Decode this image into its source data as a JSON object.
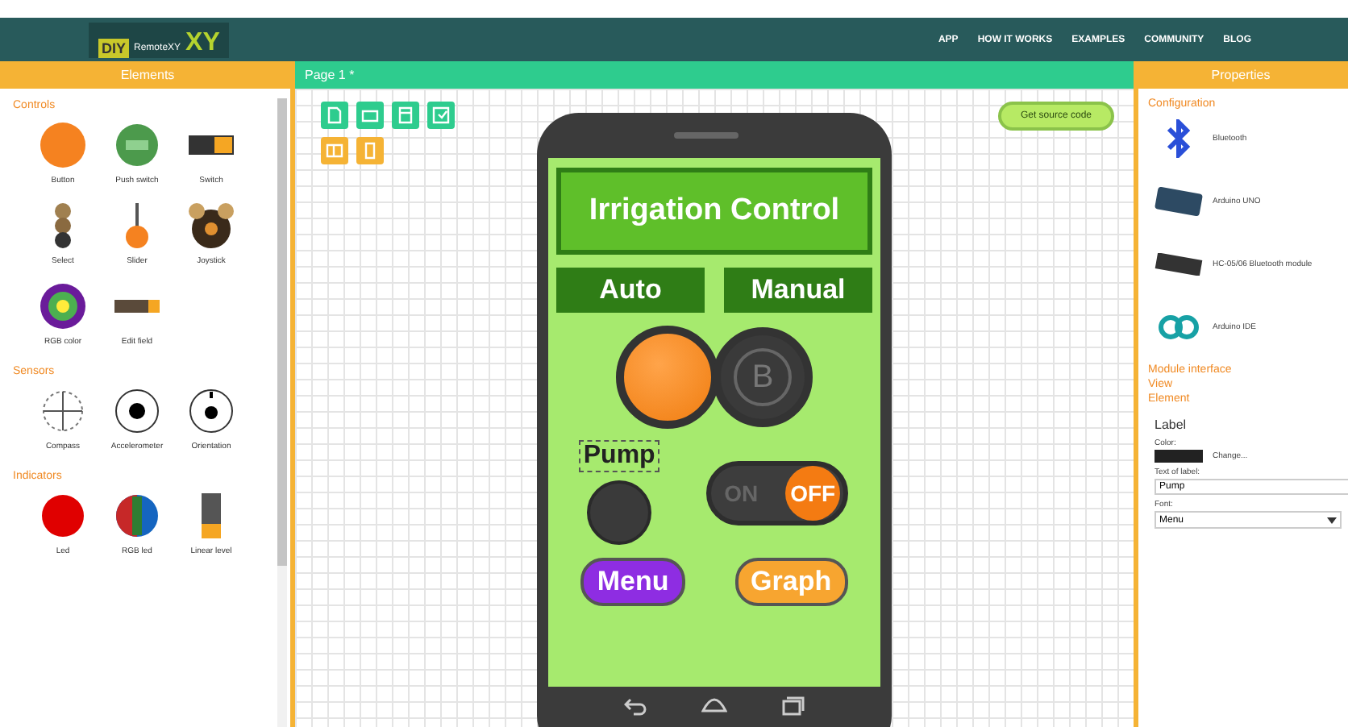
{
  "logo": {
    "badge": "DIY",
    "mark": "XY",
    "sub": "RemoteXY"
  },
  "nav": [
    "APP",
    "HOW IT WORKS",
    "EXAMPLES",
    "COMMUNITY",
    "BLOG"
  ],
  "panels": {
    "left": "Elements",
    "center": "Page 1 *",
    "right": "Properties"
  },
  "palette": [
    {
      "title": "Controls",
      "items": [
        {
          "kind": "button",
          "label": "Button"
        },
        {
          "kind": "push",
          "label": "Push switch"
        },
        {
          "kind": "switch",
          "label": "Switch"
        },
        {
          "kind": "select",
          "label": "Select"
        },
        {
          "kind": "slider",
          "label": "Slider"
        },
        {
          "kind": "joystick",
          "label": "Joystick"
        },
        {
          "kind": "rgb",
          "label": "RGB color"
        },
        {
          "kind": "edit",
          "label": "Edit field"
        }
      ]
    },
    {
      "title": "Sensors",
      "items": [
        {
          "kind": "compass",
          "label": "Compass"
        },
        {
          "kind": "accel",
          "label": "Accelerometer"
        },
        {
          "kind": "orient",
          "label": "Orientation"
        }
      ]
    },
    {
      "title": "Indicators",
      "items": [
        {
          "kind": "led",
          "label": "Led"
        },
        {
          "kind": "rgbled",
          "label": "RGB led"
        },
        {
          "kind": "level",
          "label": "Linear level"
        }
      ]
    }
  ],
  "source_button": "Get source code",
  "app": {
    "title": "Irrigation Control",
    "tabs": [
      {
        "label": "Auto"
      },
      {
        "label": "Manual"
      }
    ],
    "button_b": "B",
    "label": {
      "text": "Pump",
      "selected": true
    },
    "led": {
      "on": false
    },
    "switch": {
      "on_text": "ON",
      "off_text": "OFF",
      "on": false
    },
    "buttons": [
      {
        "label": "Menu",
        "color": "#8e2de2"
      },
      {
        "label": "Graph",
        "color": "#f7a530"
      }
    ]
  },
  "configuration": {
    "title": "Configuration",
    "items": [
      {
        "kind": "bluetooth",
        "label": "Bluetooth"
      },
      {
        "kind": "uno",
        "label": "Arduino UNO"
      },
      {
        "kind": "module",
        "label": "HC-05/06 Bluetooth module"
      },
      {
        "kind": "ide",
        "label": "Arduino IDE"
      }
    ]
  },
  "sections": [
    {
      "label": "Module interface",
      "expanded": false
    },
    {
      "label": "View",
      "expanded": false
    },
    {
      "label": "Element",
      "expanded": false
    }
  ],
  "element": {
    "heading": "Label",
    "color_label": "Color:",
    "color": "#222222",
    "change": "Change...",
    "text_label": "Text of label:",
    "text_value": "Pump",
    "font_label": "Font:",
    "font_value": "Menu"
  }
}
